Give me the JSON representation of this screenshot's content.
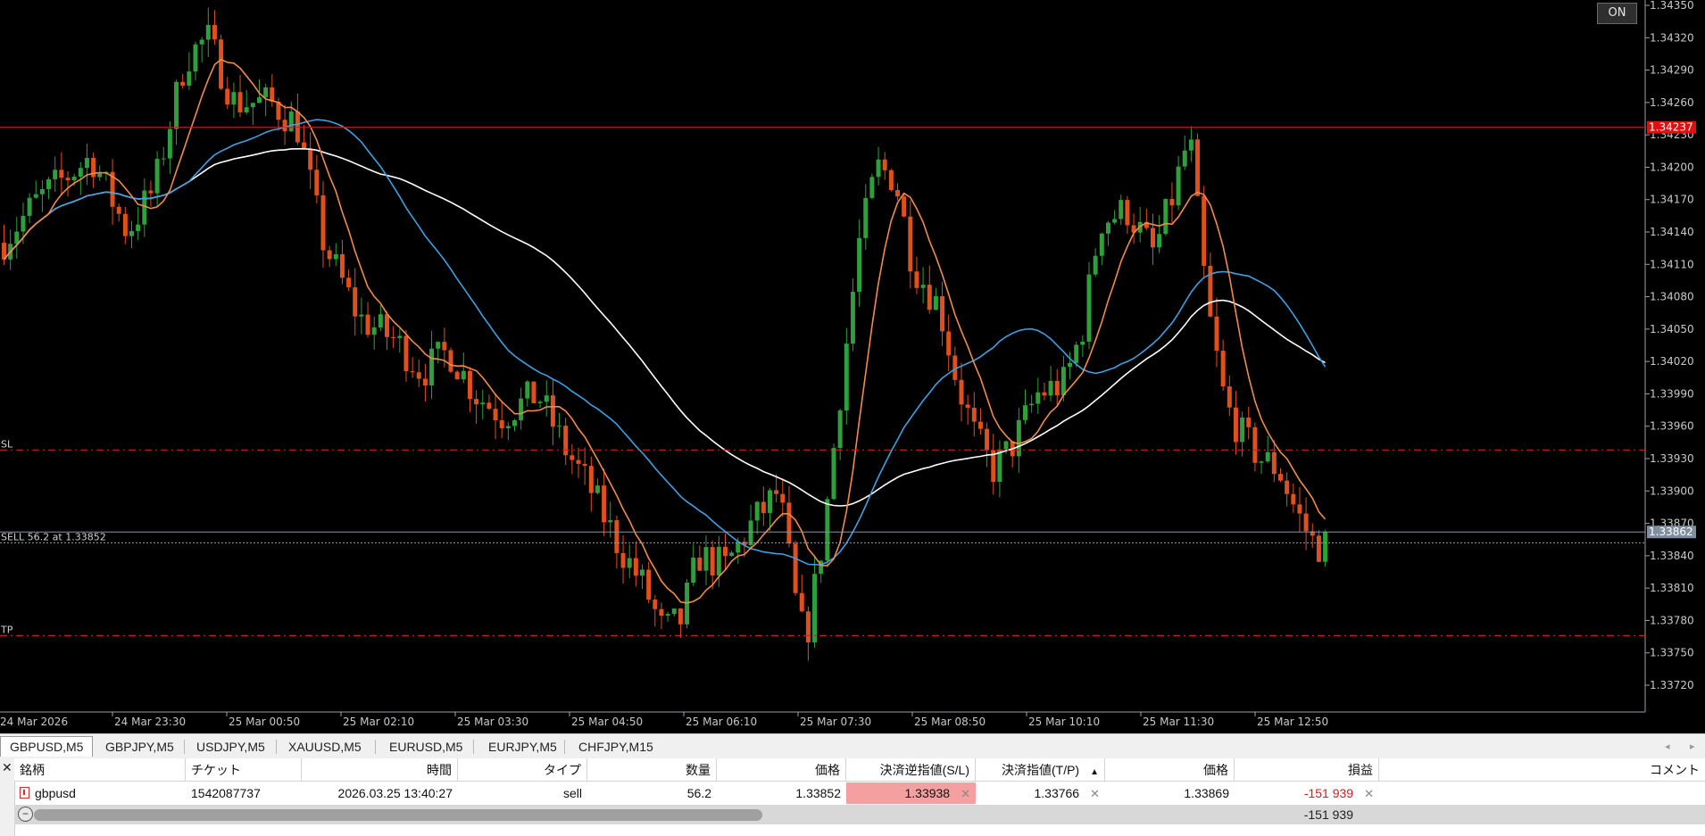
{
  "chart": {
    "price_ticks": [
      "1.34350",
      "1.34320",
      "1.34290",
      "1.34260",
      "1.34230",
      "1.34200",
      "1.34170",
      "1.34140",
      "1.34110",
      "1.34080",
      "1.34050",
      "1.34020",
      "1.33990",
      "1.33960",
      "1.33930",
      "1.33900",
      "1.33870",
      "1.33840",
      "1.33810",
      "1.33780",
      "1.33750",
      "1.33720"
    ],
    "time_ticks": [
      "24 Mar 2026",
      "24 Mar 23:30",
      "25 Mar 00:50",
      "25 Mar 02:10",
      "25 Mar 03:30",
      "25 Mar 04:50",
      "25 Mar 06:10",
      "25 Mar 07:30",
      "25 Mar 08:50",
      "25 Mar 10:10",
      "25 Mar 11:30",
      "25 Mar 12:50"
    ],
    "labels": {
      "sl": "SL",
      "tp": "TP",
      "order": "SELL 56.2 at 1.33852"
    },
    "ask_price": "1.34237",
    "bid_price": "1.33862",
    "on_button": "ON",
    "colors": {
      "bull": "#2e9f3a",
      "bear": "#e0501c",
      "ma_fast": "#f08c4a",
      "ma_mid": "#3fa0e0",
      "ma_slow": "#ffffff",
      "ask_line": "#d01818",
      "sl_tp_line": "#c42020",
      "price_marker_ask": "#e01010",
      "price_marker_bid": "#7f8fa0"
    }
  },
  "tabs": [
    {
      "label": "GBPUSD,M5",
      "active": true
    },
    {
      "label": "GBPJPY,M5",
      "active": false
    },
    {
      "label": "USDJPY,M5",
      "active": false
    },
    {
      "label": "XAUUSD,M5",
      "active": false
    },
    {
      "label": "EURUSD,M5",
      "active": false
    },
    {
      "label": "EURJPY,M5",
      "active": false
    },
    {
      "label": "CHFJPY,M15",
      "active": false
    }
  ],
  "terminal": {
    "columns": [
      "銘柄",
      "チケット",
      "時間",
      "タイプ",
      "数量",
      "価格",
      "決済逆指値(S/L)",
      "決済指値(T/P)",
      "価格",
      "損益",
      "コメント"
    ],
    "sort_indicator": "▲",
    "row": {
      "symbol": "gbpusd",
      "ticket": "1542087737",
      "time": "2026.03.25 13:40:27",
      "type": "sell",
      "volume": "56.2",
      "price": "1.33852",
      "sl": "1.33938",
      "tp": "1.33766",
      "current_price": "1.33869",
      "profit": "-151 939",
      "comment": ""
    },
    "total_profit": "-151 939",
    "close_label": "✕",
    "x_mark": "✕"
  }
}
